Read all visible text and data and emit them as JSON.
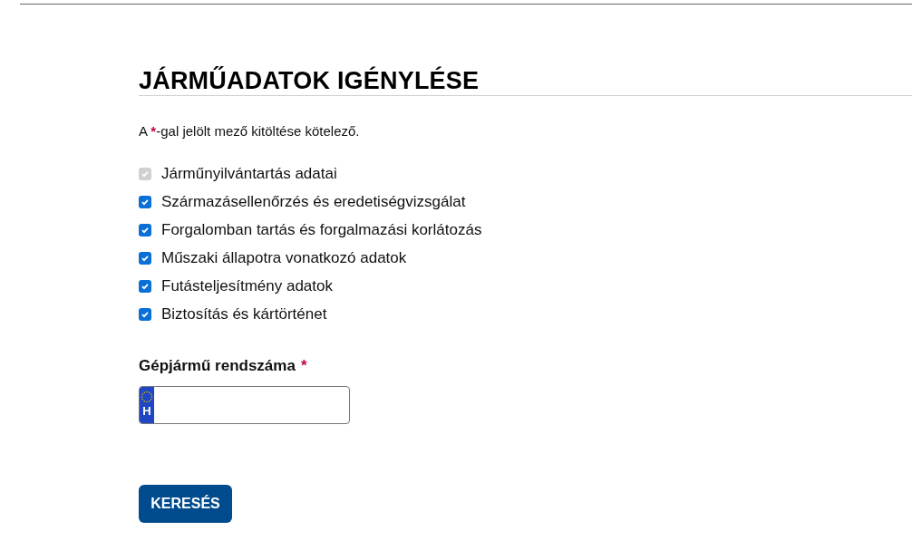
{
  "heading": "JÁRMŰADATOK IGÉNYLÉSE",
  "note": {
    "before": "A ",
    "mark": "*",
    "after": "-gal jelölt mező kitöltése kötelező."
  },
  "options": [
    {
      "label": "Járműnyilvántartás adatai",
      "checked": true,
      "disabled": true
    },
    {
      "label": "Származásellenőrzés és eredetiségvizsgálat",
      "checked": true,
      "disabled": false
    },
    {
      "label": "Forgalomban tartás és forgalmazási korlátozás",
      "checked": true,
      "disabled": false
    },
    {
      "label": "Műszaki állapotra vonatkozó adatok",
      "checked": true,
      "disabled": false
    },
    {
      "label": "Futásteljesítmény adatok",
      "checked": true,
      "disabled": false
    },
    {
      "label": "Biztosítás és kártörténet",
      "checked": true,
      "disabled": false
    }
  ],
  "plate_field": {
    "label": "Gépjármű rendszáma",
    "required_mark": "*",
    "country_code": "H"
  },
  "submit": "KERESÉS"
}
